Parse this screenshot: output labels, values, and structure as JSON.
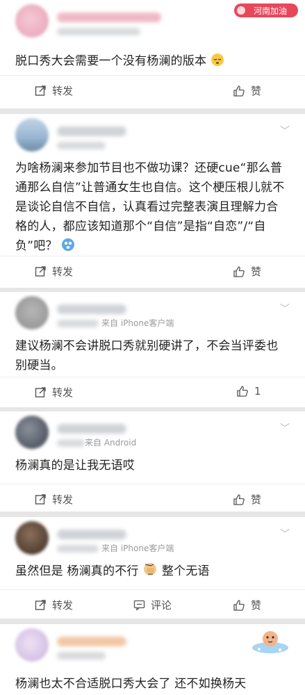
{
  "watermark": "河南加油",
  "comments": [
    {
      "text": "脱口秀大会需要一个没有杨澜的版本",
      "meta": "",
      "actions": {
        "repost": "转发",
        "like": "赞"
      }
    },
    {
      "text": "为啥杨澜来参加节目也不做功课？还硬cue“那么普通那么自信”让普通女生也自信。这个梗压根儿就不是谈论自信不自信，认真看过完整表演且理解力合格的人，都应该知道那个“自信”是指“自恋”/“自负”吧？",
      "meta": "",
      "actions": {
        "repost": "转发",
        "like": "赞"
      }
    },
    {
      "text": "建议杨澜不会讲脱口秀就别硬讲了，不会当评委也别硬当。",
      "meta": "来自 iPhone客户端",
      "actions": {
        "repost": "转发",
        "like": "1"
      }
    },
    {
      "text": "杨澜真的是让我无语哎",
      "meta": "来自 Android",
      "actions": {
        "repost": "转发",
        "like": "赞"
      }
    },
    {
      "text": "虽然但是 杨澜真的不行",
      "text2": " 整个无语",
      "meta": "来自 iPhone客户端",
      "actions": {
        "repost": "转发",
        "comment": "评论",
        "like": "赞"
      }
    },
    {
      "text": "杨澜也太不合适脱口秀大会了 还不如换杨天",
      "meta": "",
      "actions": {}
    }
  ]
}
